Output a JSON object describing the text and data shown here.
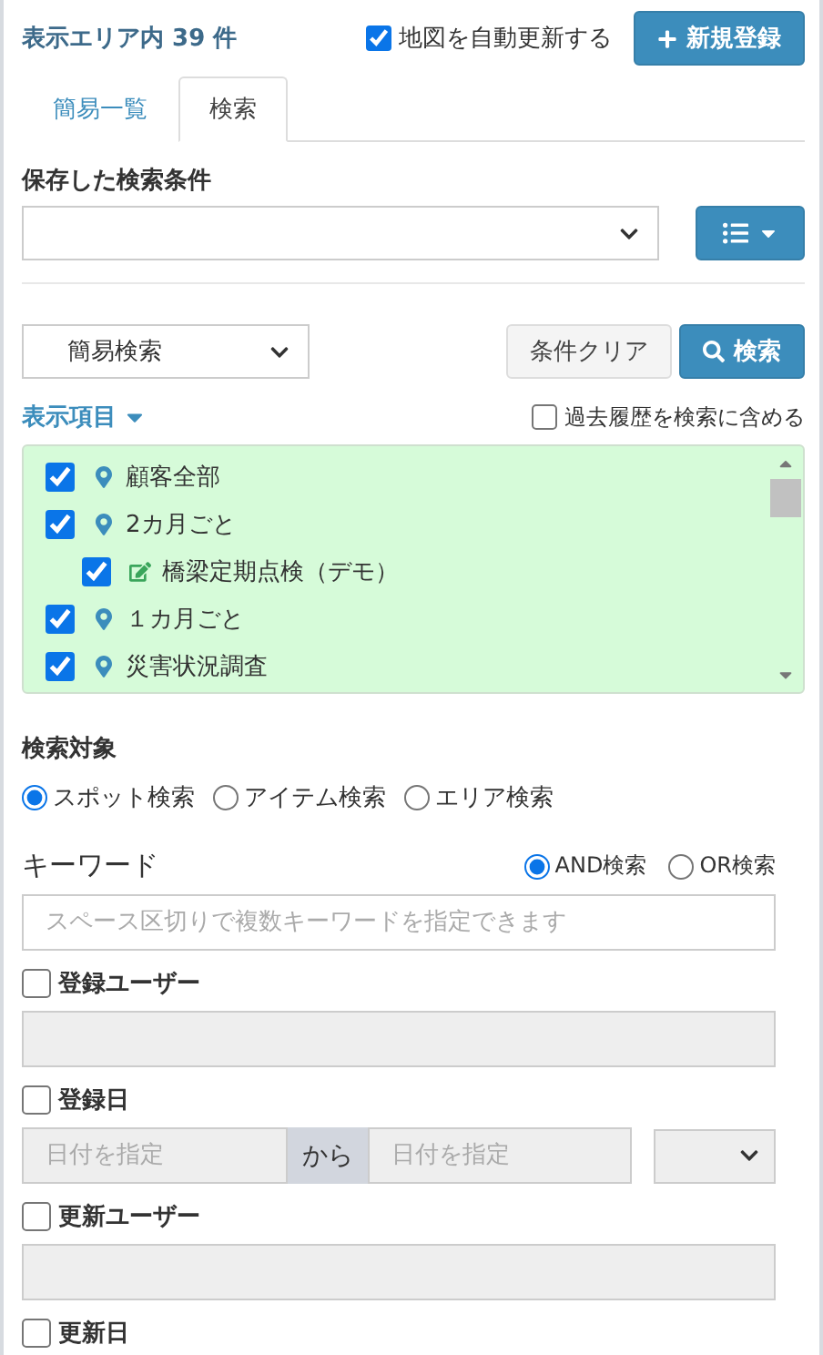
{
  "header": {
    "count_label": "表示エリア内",
    "count": "39",
    "count_unit": "件",
    "auto_update": {
      "label": "地図を自動更新する",
      "checked": true
    },
    "new_button": "新規登録"
  },
  "tabs": [
    {
      "label": "簡易一覧",
      "selected": false
    },
    {
      "label": "検索",
      "selected": true
    }
  ],
  "saved_search": {
    "label": "保存した検索条件"
  },
  "search_mode": {
    "value": "簡易検索",
    "clear_button": "条件クリア",
    "search_button": "検索"
  },
  "display_items": {
    "label": "表示項目",
    "include_history": {
      "label": "過去履歴を検索に含める",
      "checked": false
    },
    "items": [
      {
        "label": "顧客全部",
        "kind": "pin",
        "checked": true
      },
      {
        "label": "2カ月ごと",
        "kind": "pin",
        "checked": true,
        "children": [
          {
            "label": "橋梁定期点検（デモ）",
            "kind": "edit",
            "checked": true
          }
        ]
      },
      {
        "label": "１カ月ごと",
        "kind": "pin",
        "checked": true
      },
      {
        "label": "災害状況調査",
        "kind": "pin",
        "checked": true
      }
    ]
  },
  "search_target": {
    "label": "検索対象",
    "options": [
      {
        "label": "スポット検索",
        "selected": true
      },
      {
        "label": "アイテム検索",
        "selected": false
      },
      {
        "label": "エリア検索",
        "selected": false
      }
    ]
  },
  "keyword": {
    "label": "キーワード",
    "placeholder": "スペース区切りで複数キーワードを指定できます",
    "modes": [
      {
        "label": "AND検索",
        "selected": true
      },
      {
        "label": "OR検索",
        "selected": false
      }
    ]
  },
  "filters": [
    {
      "kind": "text",
      "label": "登録ユーザー",
      "checked": false
    },
    {
      "kind": "date",
      "label": "登録日",
      "checked": false,
      "from_placeholder": "日付を指定",
      "separator": "から",
      "to_placeholder": "日付を指定"
    },
    {
      "kind": "text",
      "label": "更新ユーザー",
      "checked": false
    },
    {
      "kind": "label",
      "label": "更新日",
      "checked": false
    }
  ]
}
